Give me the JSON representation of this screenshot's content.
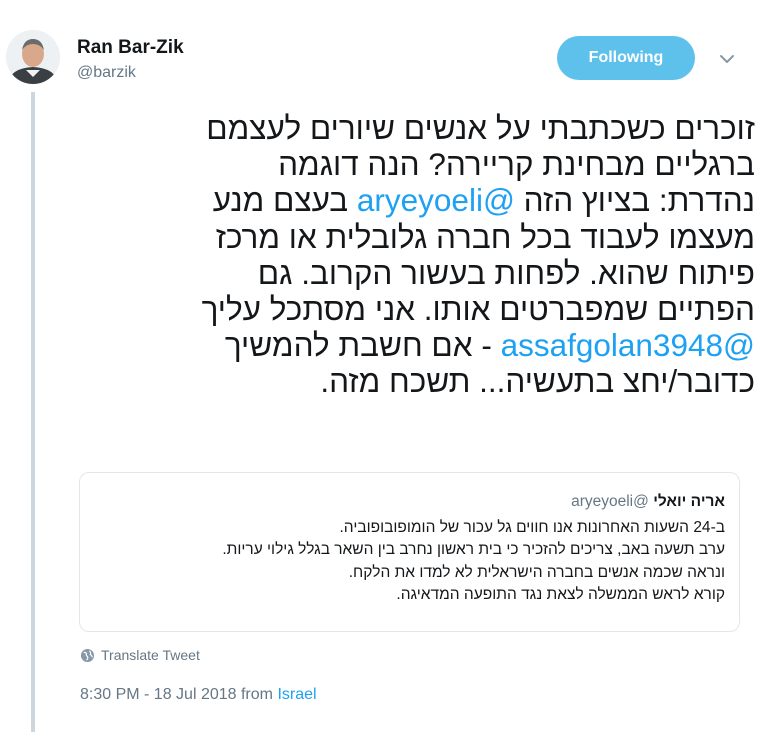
{
  "author": {
    "name": "Ran Bar-Zik",
    "handle": "@barzik"
  },
  "follow_button": {
    "label": "Following"
  },
  "menu_icon": "chevron-down-icon",
  "tweet": {
    "lines": [
      "זוכרים כשכתבתי על אנשים שיורים לעצמם",
      "ברגליים מבחינת קריירה? הנה דוגמה",
      {
        "before": "נהדרת: בציוץ הזה ",
        "mention": "@aryeyoeli",
        "after": " בעצם מנע"
      },
      "מעצמו לעבוד בכל חברה גלובלית או מרכז",
      "פיתוח שהוא. לפחות בעשור הקרוב. גם",
      "הפתיים שמפברטים אותו. אני מסתכל עליך",
      {
        "before": "",
        "mention": "@assafgolan3948",
        "after": " - אם חשבת להמשיך"
      },
      "כדובר/יחצ בתעשיה... תשכח מזה."
    ]
  },
  "quoted_tweet": {
    "name": "אריה יואלי",
    "handle": "@aryeyoeli",
    "lines": [
      "ב-24 השעות האחרונות אנו חווים גל עכור של הומופובופוביה.",
      "ערב תשעה באב, צריכים להזכיר כי בית ראשון נחרב בין השאר בגלל גילוי עריות.",
      "ונראה שכמה אנשים בחברה הישראלית לא למדו את הלקח.",
      "קורא לראש הממשלה לצאת נגד התופעה המדאיגה."
    ]
  },
  "translate": {
    "label": "Translate Tweet",
    "icon": "globe-icon"
  },
  "meta": {
    "timestamp": "8:30 PM - 18 Jul 2018 from ",
    "location": "Israel"
  },
  "colors": {
    "accent": "#1da1f2",
    "follow_bg": "#5ec1ec",
    "muted": "#657786",
    "thread_line": "#ccd6dd"
  }
}
